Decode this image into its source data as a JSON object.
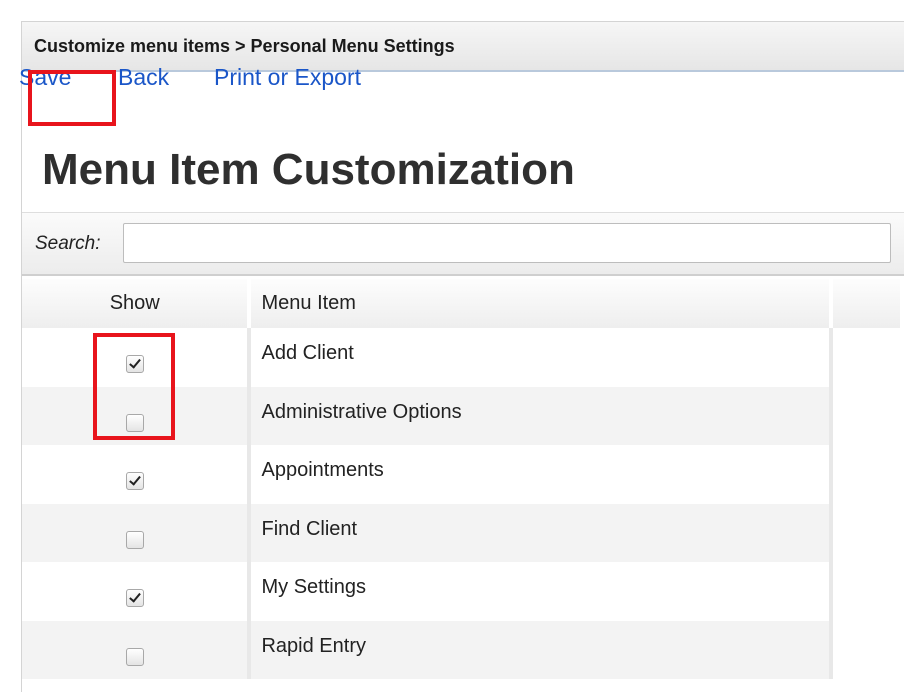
{
  "breadcrumb": "Customize menu items > Personal Menu Settings",
  "toolbar": {
    "save_label": "Save",
    "back_label": "Back",
    "print_label": "Print or Export"
  },
  "page_title": "Menu Item Customization",
  "search": {
    "label": "Search:",
    "value": "",
    "placeholder": ""
  },
  "table": {
    "headers": [
      "Show",
      "Menu Item"
    ],
    "rows": [
      {
        "label": "Add Client",
        "checked": true
      },
      {
        "label": "Administrative Options",
        "checked": false
      },
      {
        "label": "Appointments",
        "checked": true
      },
      {
        "label": "Find Client",
        "checked": false
      },
      {
        "label": "My Settings",
        "checked": true
      },
      {
        "label": "Rapid Entry",
        "checked": false
      }
    ]
  },
  "colors": {
    "link": "#1a56c8",
    "highlight_box": "#e8141c"
  }
}
